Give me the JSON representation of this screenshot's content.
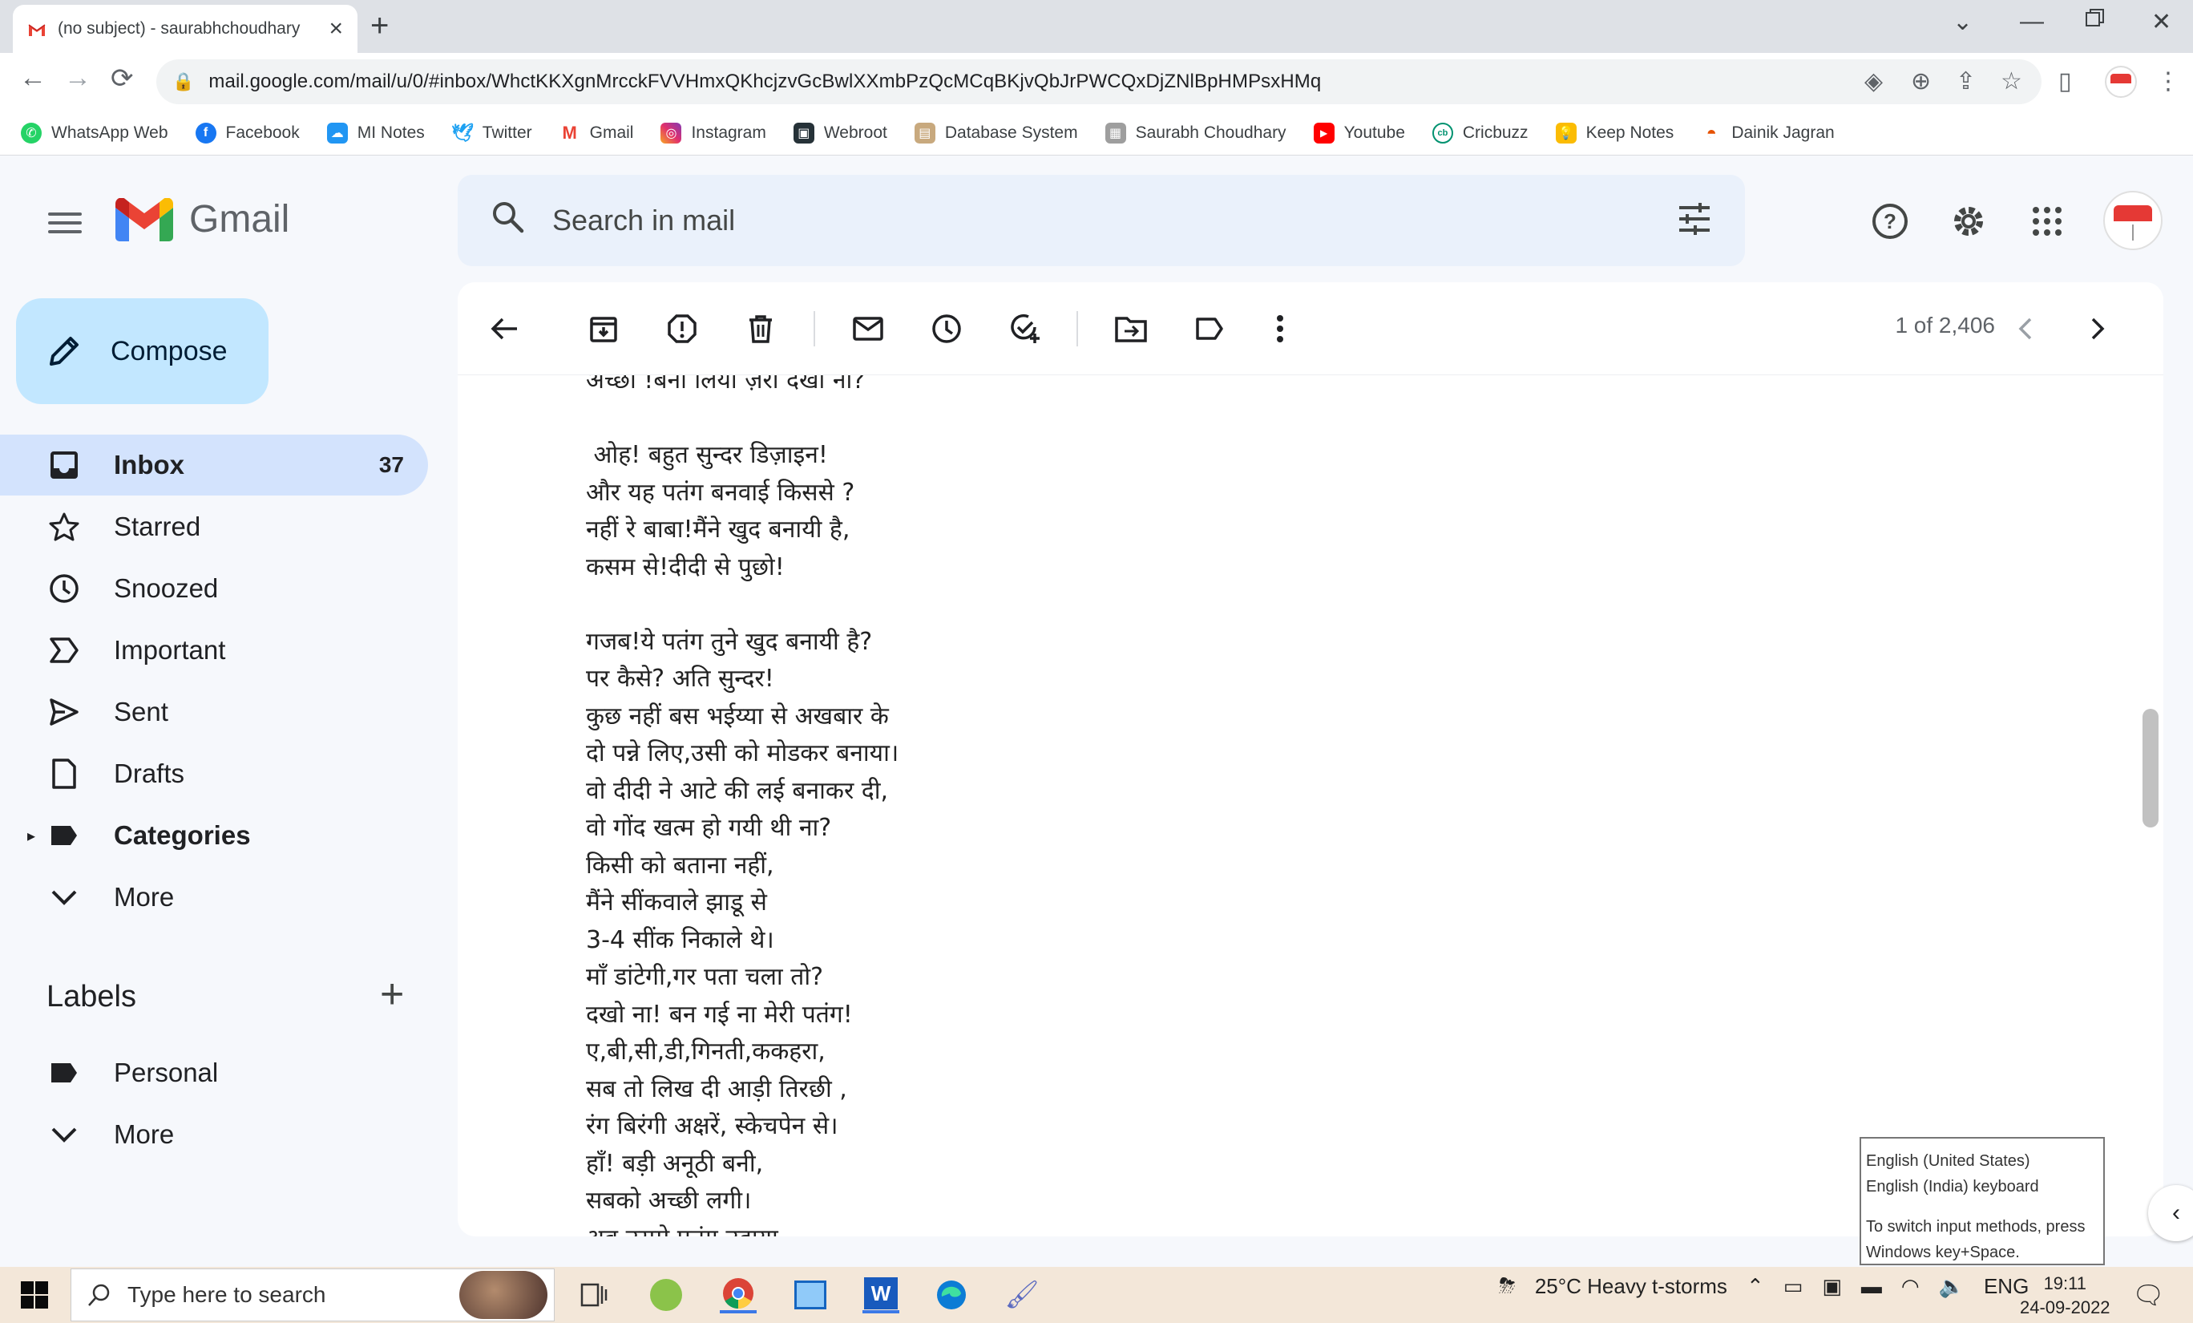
{
  "browser": {
    "tab_title": "(no subject) - saurabhchoudhary",
    "url": "mail.google.com/mail/u/0/#inbox/WhctKKXgnMrcckFVVHmxQKhcjzvGcBwlXXmbPzQcMCqBKjvQbJrPWCQxDjZNlBpHMPsxHMq",
    "bookmarks": [
      "WhatsApp Web",
      "Facebook",
      "MI Notes",
      "Twitter",
      "Gmail",
      "Instagram",
      "Webroot",
      "Database System",
      "Saurabh Choudhary",
      "Youtube",
      "Cricbuzz",
      "Keep Notes",
      "Dainik Jagran"
    ]
  },
  "gmail": {
    "logo_text": "Gmail",
    "search_placeholder": "Search in mail",
    "compose_label": "Compose",
    "nav": [
      {
        "label": "Inbox",
        "count": "37"
      },
      {
        "label": "Starred"
      },
      {
        "label": "Snoozed"
      },
      {
        "label": "Important"
      },
      {
        "label": "Sent"
      },
      {
        "label": "Drafts"
      },
      {
        "label": "Categories"
      },
      {
        "label": "More"
      }
    ],
    "labels_heading": "Labels",
    "labels": [
      {
        "label": "Personal"
      },
      {
        "label": "More"
      }
    ],
    "pager_text": "1 of 2,406",
    "body_lines": [
      "अच्छा !बना लिया ज़रा दखा ना?",
      "",
      " ओह! बहुत सुन्दर डिज़ाइन!",
      "और यह पतंग बनवाई किससे ?",
      "नहीं रे बाबा!मैंने खुद बनायी है,",
      "कसम से!दीदी से पुछो!",
      "",
      "गजब!ये पतंग तुने खुद बनायी है?",
      "पर कैसे? अति सुन्दर!",
      "कुछ नहीं बस भईय्या से अखबार के",
      "दो पन्ने लिए,उसी को मोडकर बनाया।",
      "वो दीदी ने आटे की लई बनाकर दी,",
      "वो गोंद खत्म हो गयी थी ना?",
      "किसी को बताना नहीं,",
      "मैंने सींकवाले झाडू से",
      "3-4 सींक निकाले थे।",
      "माँ डांटेगी,गर पता चला तो?",
      "दखो ना! बन गई ना मेरी पतंग!",
      "ए,बी,सी,डी,गिनती,ककहरा,",
      "सब तो लिख दी आड़ी तिरछी ,",
      "रंग बिरंगी अक्षरें, स्केचपेन से।",
      "हाँ! बड़ी अनूठी बनी,",
      "सबको अच्छी लगी।",
      "अब उसमे पतंग उड़ाया"
    ]
  },
  "ime_popup": {
    "line1": "English (United States)",
    "line2": "English (India) keyboard",
    "line3": "To switch input methods, press",
    "line4": "Windows key+Space."
  },
  "taskbar": {
    "search_placeholder": "Type here to search",
    "weather": "25°C  Heavy t-storms",
    "lang": "ENG",
    "time": "19:11",
    "date": "24-09-2022"
  },
  "colors": {
    "gmail_red": "#ea4335",
    "active_nav": "#d3e3fd",
    "compose": "#c2e7ff",
    "search_bg": "#eaf1fb"
  }
}
